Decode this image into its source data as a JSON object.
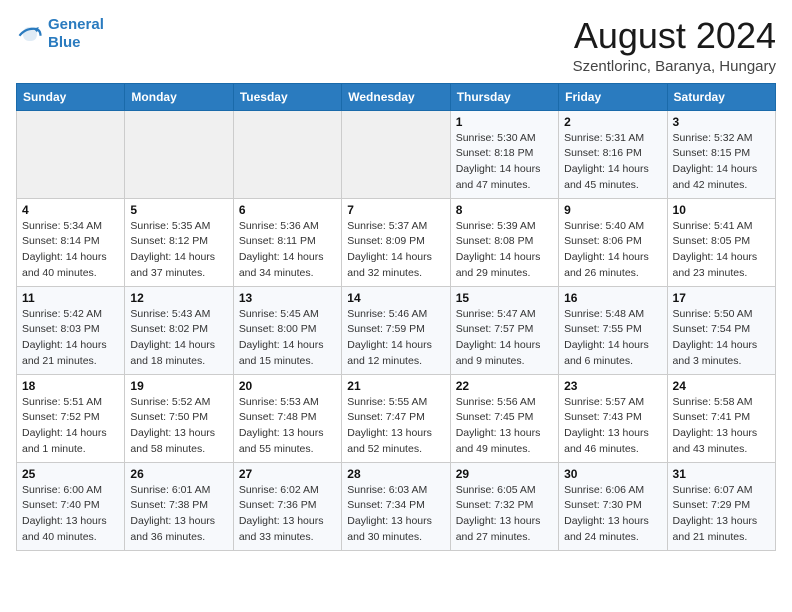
{
  "logo": {
    "line1": "General",
    "line2": "Blue"
  },
  "title": "August 2024",
  "location": "Szentlorinc, Baranya, Hungary",
  "weekdays": [
    "Sunday",
    "Monday",
    "Tuesday",
    "Wednesday",
    "Thursday",
    "Friday",
    "Saturday"
  ],
  "weeks": [
    [
      {
        "day": "",
        "info": ""
      },
      {
        "day": "",
        "info": ""
      },
      {
        "day": "",
        "info": ""
      },
      {
        "day": "",
        "info": ""
      },
      {
        "day": "1",
        "info": "Sunrise: 5:30 AM\nSunset: 8:18 PM\nDaylight: 14 hours\nand 47 minutes."
      },
      {
        "day": "2",
        "info": "Sunrise: 5:31 AM\nSunset: 8:16 PM\nDaylight: 14 hours\nand 45 minutes."
      },
      {
        "day": "3",
        "info": "Sunrise: 5:32 AM\nSunset: 8:15 PM\nDaylight: 14 hours\nand 42 minutes."
      }
    ],
    [
      {
        "day": "4",
        "info": "Sunrise: 5:34 AM\nSunset: 8:14 PM\nDaylight: 14 hours\nand 40 minutes."
      },
      {
        "day": "5",
        "info": "Sunrise: 5:35 AM\nSunset: 8:12 PM\nDaylight: 14 hours\nand 37 minutes."
      },
      {
        "day": "6",
        "info": "Sunrise: 5:36 AM\nSunset: 8:11 PM\nDaylight: 14 hours\nand 34 minutes."
      },
      {
        "day": "7",
        "info": "Sunrise: 5:37 AM\nSunset: 8:09 PM\nDaylight: 14 hours\nand 32 minutes."
      },
      {
        "day": "8",
        "info": "Sunrise: 5:39 AM\nSunset: 8:08 PM\nDaylight: 14 hours\nand 29 minutes."
      },
      {
        "day": "9",
        "info": "Sunrise: 5:40 AM\nSunset: 8:06 PM\nDaylight: 14 hours\nand 26 minutes."
      },
      {
        "day": "10",
        "info": "Sunrise: 5:41 AM\nSunset: 8:05 PM\nDaylight: 14 hours\nand 23 minutes."
      }
    ],
    [
      {
        "day": "11",
        "info": "Sunrise: 5:42 AM\nSunset: 8:03 PM\nDaylight: 14 hours\nand 21 minutes."
      },
      {
        "day": "12",
        "info": "Sunrise: 5:43 AM\nSunset: 8:02 PM\nDaylight: 14 hours\nand 18 minutes."
      },
      {
        "day": "13",
        "info": "Sunrise: 5:45 AM\nSunset: 8:00 PM\nDaylight: 14 hours\nand 15 minutes."
      },
      {
        "day": "14",
        "info": "Sunrise: 5:46 AM\nSunset: 7:59 PM\nDaylight: 14 hours\nand 12 minutes."
      },
      {
        "day": "15",
        "info": "Sunrise: 5:47 AM\nSunset: 7:57 PM\nDaylight: 14 hours\nand 9 minutes."
      },
      {
        "day": "16",
        "info": "Sunrise: 5:48 AM\nSunset: 7:55 PM\nDaylight: 14 hours\nand 6 minutes."
      },
      {
        "day": "17",
        "info": "Sunrise: 5:50 AM\nSunset: 7:54 PM\nDaylight: 14 hours\nand 3 minutes."
      }
    ],
    [
      {
        "day": "18",
        "info": "Sunrise: 5:51 AM\nSunset: 7:52 PM\nDaylight: 14 hours\nand 1 minute."
      },
      {
        "day": "19",
        "info": "Sunrise: 5:52 AM\nSunset: 7:50 PM\nDaylight: 13 hours\nand 58 minutes."
      },
      {
        "day": "20",
        "info": "Sunrise: 5:53 AM\nSunset: 7:48 PM\nDaylight: 13 hours\nand 55 minutes."
      },
      {
        "day": "21",
        "info": "Sunrise: 5:55 AM\nSunset: 7:47 PM\nDaylight: 13 hours\nand 52 minutes."
      },
      {
        "day": "22",
        "info": "Sunrise: 5:56 AM\nSunset: 7:45 PM\nDaylight: 13 hours\nand 49 minutes."
      },
      {
        "day": "23",
        "info": "Sunrise: 5:57 AM\nSunset: 7:43 PM\nDaylight: 13 hours\nand 46 minutes."
      },
      {
        "day": "24",
        "info": "Sunrise: 5:58 AM\nSunset: 7:41 PM\nDaylight: 13 hours\nand 43 minutes."
      }
    ],
    [
      {
        "day": "25",
        "info": "Sunrise: 6:00 AM\nSunset: 7:40 PM\nDaylight: 13 hours\nand 40 minutes."
      },
      {
        "day": "26",
        "info": "Sunrise: 6:01 AM\nSunset: 7:38 PM\nDaylight: 13 hours\nand 36 minutes."
      },
      {
        "day": "27",
        "info": "Sunrise: 6:02 AM\nSunset: 7:36 PM\nDaylight: 13 hours\nand 33 minutes."
      },
      {
        "day": "28",
        "info": "Sunrise: 6:03 AM\nSunset: 7:34 PM\nDaylight: 13 hours\nand 30 minutes."
      },
      {
        "day": "29",
        "info": "Sunrise: 6:05 AM\nSunset: 7:32 PM\nDaylight: 13 hours\nand 27 minutes."
      },
      {
        "day": "30",
        "info": "Sunrise: 6:06 AM\nSunset: 7:30 PM\nDaylight: 13 hours\nand 24 minutes."
      },
      {
        "day": "31",
        "info": "Sunrise: 6:07 AM\nSunset: 7:29 PM\nDaylight: 13 hours\nand 21 minutes."
      }
    ]
  ]
}
